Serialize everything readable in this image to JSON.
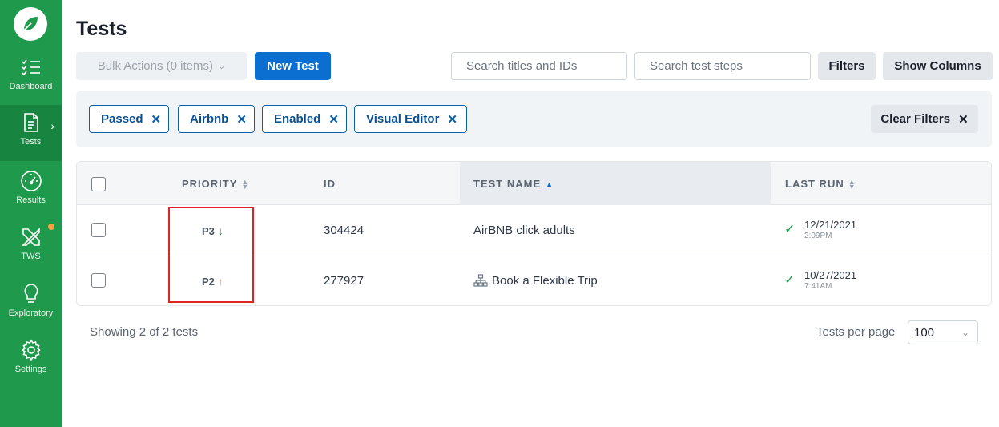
{
  "sidebar": {
    "items": [
      {
        "label": "Dashboard",
        "icon": "checklist-icon"
      },
      {
        "label": "Tests",
        "icon": "document-icon",
        "active": true
      },
      {
        "label": "Results",
        "icon": "gauge-icon"
      },
      {
        "label": "TWS",
        "icon": "tools-icon"
      },
      {
        "label": "Exploratory",
        "icon": "lightbulb-icon"
      },
      {
        "label": "Settings",
        "icon": "gear-icon"
      }
    ]
  },
  "header": {
    "title": "Tests",
    "bulk_actions_label": "Bulk Actions (0 items)",
    "new_test_label": "New Test",
    "search_titles_placeholder": "Search titles and IDs",
    "search_steps_placeholder": "Search test steps",
    "filters_label": "Filters",
    "show_columns_label": "Show Columns"
  },
  "filters": {
    "chips": [
      "Passed",
      "Airbnb",
      "Enabled",
      "Visual Editor"
    ],
    "clear_label": "Clear Filters"
  },
  "table": {
    "columns": [
      "PRIORITY",
      "ID",
      "TEST NAME",
      "LAST RUN"
    ],
    "rows": [
      {
        "priority": "P3",
        "priority_direction": "down",
        "id": "304424",
        "name": "AirBNB click adults",
        "name_icon": "",
        "date": "12/21/2021",
        "time": "2:09PM"
      },
      {
        "priority": "P2",
        "priority_direction": "up",
        "id": "277927",
        "name": "Book a Flexible Trip",
        "name_icon": "sitemap-icon",
        "date": "10/27/2021",
        "time": "7:41AM"
      }
    ]
  },
  "footer": {
    "showing_text": "Showing 2 of 2 tests",
    "per_page_label": "Tests per page",
    "per_page_value": "100"
  },
  "colors": {
    "sidebar": "#1f9a4c",
    "primary": "#0b6fd1",
    "highlight": "#e02424"
  }
}
